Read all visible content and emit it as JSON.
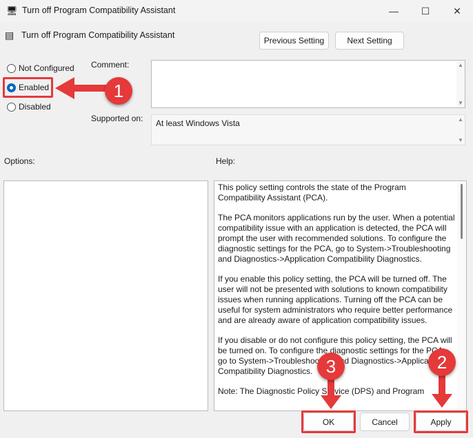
{
  "window": {
    "title": "Turn off Program Compatibility Assistant",
    "minimize": "—",
    "maximize": "☐",
    "close": "✕"
  },
  "policy_name": "Turn off Program Compatibility Assistant",
  "nav": {
    "previous": "Previous Setting",
    "next": "Next Setting"
  },
  "state": {
    "options": [
      "Not Configured",
      "Enabled",
      "Disabled"
    ],
    "selected": "Enabled"
  },
  "comment": {
    "label": "Comment:",
    "value": ""
  },
  "supported": {
    "label": "Supported on:",
    "value": "At least Windows Vista"
  },
  "options_label": "Options:",
  "help_label": "Help:",
  "help_text": [
    "This policy setting controls the state of the Program Compatibility Assistant (PCA).",
    "The PCA monitors applications run by the user. When a potential compatibility issue with an application is detected, the PCA will prompt the user with recommended solutions.  To configure the diagnostic settings for the PCA, go to System->Troubleshooting and Diagnostics->Application Compatibility Diagnostics.",
    "If you enable this policy setting, the PCA will be turned off. The user will not be presented with solutions to known compatibility issues when running applications. Turning off the PCA can be useful for system administrators who require better performance and are already aware of application compatibility issues.",
    "If you disable or do not configure this policy setting, the PCA will be turned on. To configure the diagnostic settings for the PCA, go to System->Troubleshooting and Diagnostics->Application Compatibility Diagnostics.",
    "Note: The Diagnostic Policy Service (DPS) and Program"
  ],
  "buttons": {
    "ok": "OK",
    "cancel": "Cancel",
    "apply": "Apply"
  },
  "annotations": [
    "1",
    "2",
    "3"
  ],
  "colors": {
    "annotation": "#e5393a",
    "accent": "#0067c0"
  }
}
